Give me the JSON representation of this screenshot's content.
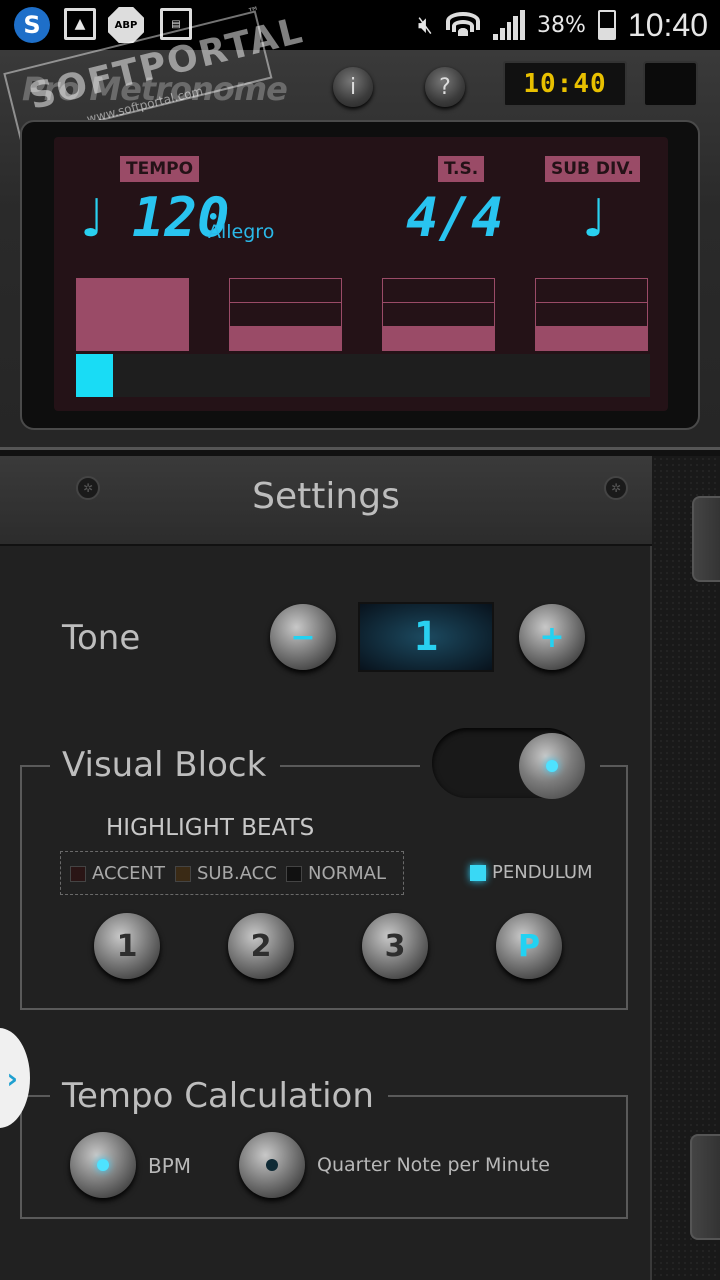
{
  "status_bar": {
    "s_icon": "S",
    "abp": "ABP",
    "battery_pct": "38%",
    "time": "10:40"
  },
  "watermark": {
    "line1": "SOFTPORTAL",
    "line2": "www.softportal.com",
    "tm": "™"
  },
  "header": {
    "app_name": "Pro Metronome",
    "info_label": "i",
    "help_label": "?",
    "clock": "10:40"
  },
  "display": {
    "tempo_tag": "TEMPO",
    "ts_tag": "T.S.",
    "subdiv_tag": "SUB DIV.",
    "tempo_note": "♩",
    "tempo_value": "120",
    "tempo_name": "Allegro",
    "time_signature": "4/4",
    "subdiv_note": "♩",
    "beats": [
      {
        "level": "accent"
      },
      {
        "level": "normal"
      },
      {
        "level": "normal"
      },
      {
        "level": "normal"
      }
    ],
    "progress_fraction": 0.065
  },
  "settings": {
    "title": "Settings",
    "tone": {
      "label": "Tone",
      "minus": "−",
      "value": "1",
      "plus": "+"
    },
    "visual_block": {
      "label": "Visual Block",
      "enabled": true,
      "highlight_title": "HIGHLIGHT BEATS",
      "legend": [
        "ACCENT",
        "SUB.ACC",
        "NORMAL"
      ],
      "pendulum": "PENDULUM",
      "buttons": [
        "1",
        "2",
        "3",
        "P"
      ]
    },
    "tempo_calc": {
      "label": "Tempo Calculation",
      "option_bpm": "BPM",
      "option_qnpm": "Quarter Note per Minute",
      "selected": "BPM"
    }
  },
  "colors": {
    "accent_cyan": "#19dcf5",
    "display_magenta": "#9a4b67",
    "clock_yellow": "#e8c000"
  },
  "icons": [
    "skype-icon",
    "image-icon",
    "adblock-icon",
    "calendar-icon",
    "mute-icon",
    "wifi-icon",
    "signal-icon",
    "battery-icon",
    "info-icon",
    "help-icon",
    "chevron-right-icon"
  ]
}
